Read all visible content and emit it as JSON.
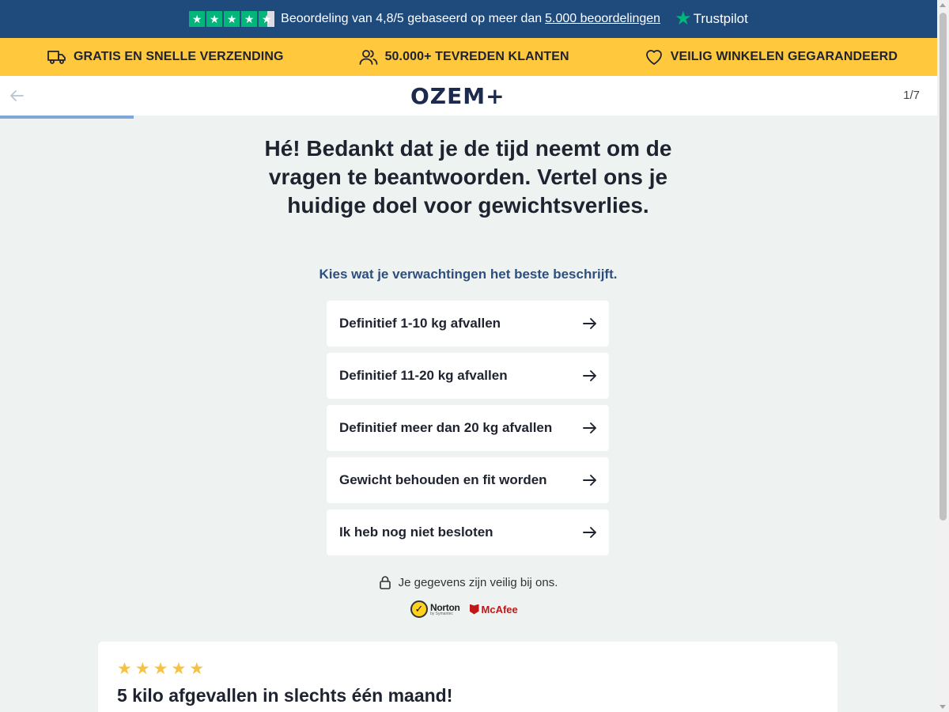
{
  "trustbar": {
    "rating_text": "Beoordeling van 4,8/5 gebaseerd op meer dan",
    "reviews_link": "5.000 beoordelingen",
    "brand": "Trustpilot",
    "stars": [
      1,
      1,
      1,
      1,
      0.5
    ],
    "star_glyph": "★",
    "star_color": "#00b67a",
    "background": "#1f4a7c"
  },
  "usp": {
    "background": "#ffc83d",
    "items": [
      {
        "icon": "truck-icon",
        "label": "GRATIS EN SNELLE VERZENDING"
      },
      {
        "icon": "users-icon",
        "label": "50.000+ TEVREDEN KLANTEN"
      },
      {
        "icon": "heart-icon",
        "label": "VEILIG WINKELEN GEGARANDEERD"
      }
    ]
  },
  "header": {
    "logo": "OZEM+",
    "step": "1/7",
    "back_icon": "arrow-left-icon",
    "progress_fraction": 0.1429,
    "progress_color": "#7ea6d6"
  },
  "quiz": {
    "headline": "Hé! Bedankt dat je de tijd neemt om de vragen te beantwoorden. Vertel ons je huidige doel voor gewichtsverlies.",
    "subline": "Kies wat je verwachtingen het beste beschrijft.",
    "options": [
      {
        "label": "Definitief 1-10 kg afvallen"
      },
      {
        "label": "Definitief 11-20 kg afvallen"
      },
      {
        "label": "Definitief meer dan 20 kg afvallen"
      },
      {
        "label": "Gewicht behouden en fit worden"
      },
      {
        "label": "Ik heb nog niet besloten"
      }
    ],
    "option_icon": "arrow-right-icon"
  },
  "security": {
    "text": "Je gegevens zijn veilig bij ons.",
    "icon": "lock-icon",
    "norton_name": "Norton",
    "norton_sub": "by Symantec",
    "mcafee_name": "McAfee"
  },
  "review": {
    "stars": 5,
    "star_glyph": "★",
    "star_color": "#f5c242",
    "title": "5 kilo afgevallen in slechts één maand!"
  }
}
